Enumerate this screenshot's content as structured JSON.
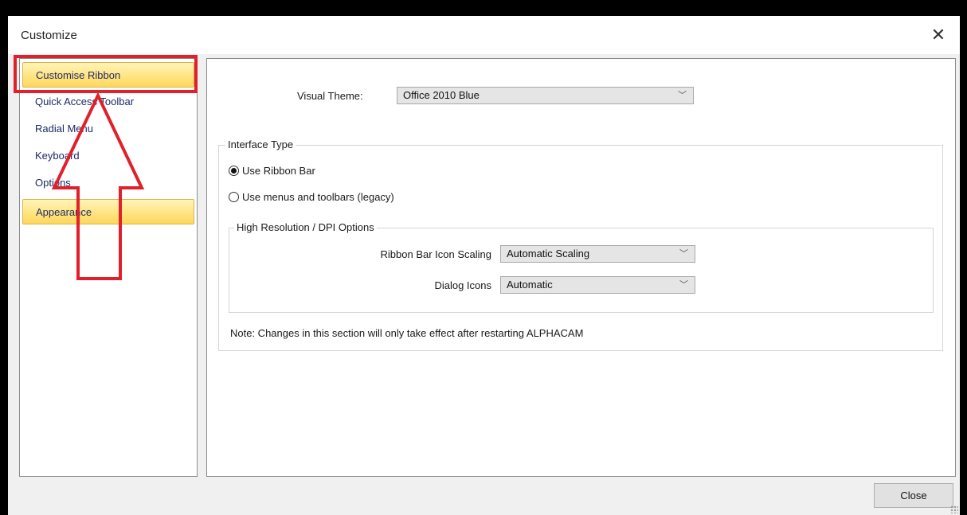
{
  "window": {
    "title": "Customize",
    "close_glyph": "✕"
  },
  "sidebar": {
    "items": [
      {
        "label": "Customise Ribbon",
        "active": true
      },
      {
        "label": "Quick Access Toolbar",
        "active": false
      },
      {
        "label": "Radial Menu",
        "active": false
      },
      {
        "label": "Keyboard",
        "active": false
      },
      {
        "label": "Options",
        "active": false
      },
      {
        "label": "Appearance",
        "active": true
      }
    ]
  },
  "main": {
    "visual_theme": {
      "label": "Visual Theme:",
      "value": "Office 2010 Blue"
    },
    "interface_type": {
      "legend": "Interface Type",
      "options": [
        {
          "label": "Use Ribbon Bar",
          "checked": true
        },
        {
          "label": "Use menus and toolbars (legacy)",
          "checked": false
        }
      ]
    },
    "dpi_options": {
      "legend": "High Resolution / DPI Options",
      "ribbon_scaling_label": "Ribbon Bar Icon Scaling",
      "ribbon_scaling_value": "Automatic Scaling",
      "dialog_icons_label": "Dialog Icons",
      "dialog_icons_value": "Automatic"
    },
    "note": "Note: Changes in this section will only take effect after restarting ALPHACAM"
  },
  "footer": {
    "close_label": "Close"
  },
  "icons": {
    "dropdown": "chevron-down-icon",
    "chevron_glyph": "﹀"
  },
  "colors": {
    "annotation": "#e0202a",
    "active_item_top": "#fff4b8",
    "active_item_bottom": "#ffd75a",
    "nav_text": "#1c2a66"
  }
}
